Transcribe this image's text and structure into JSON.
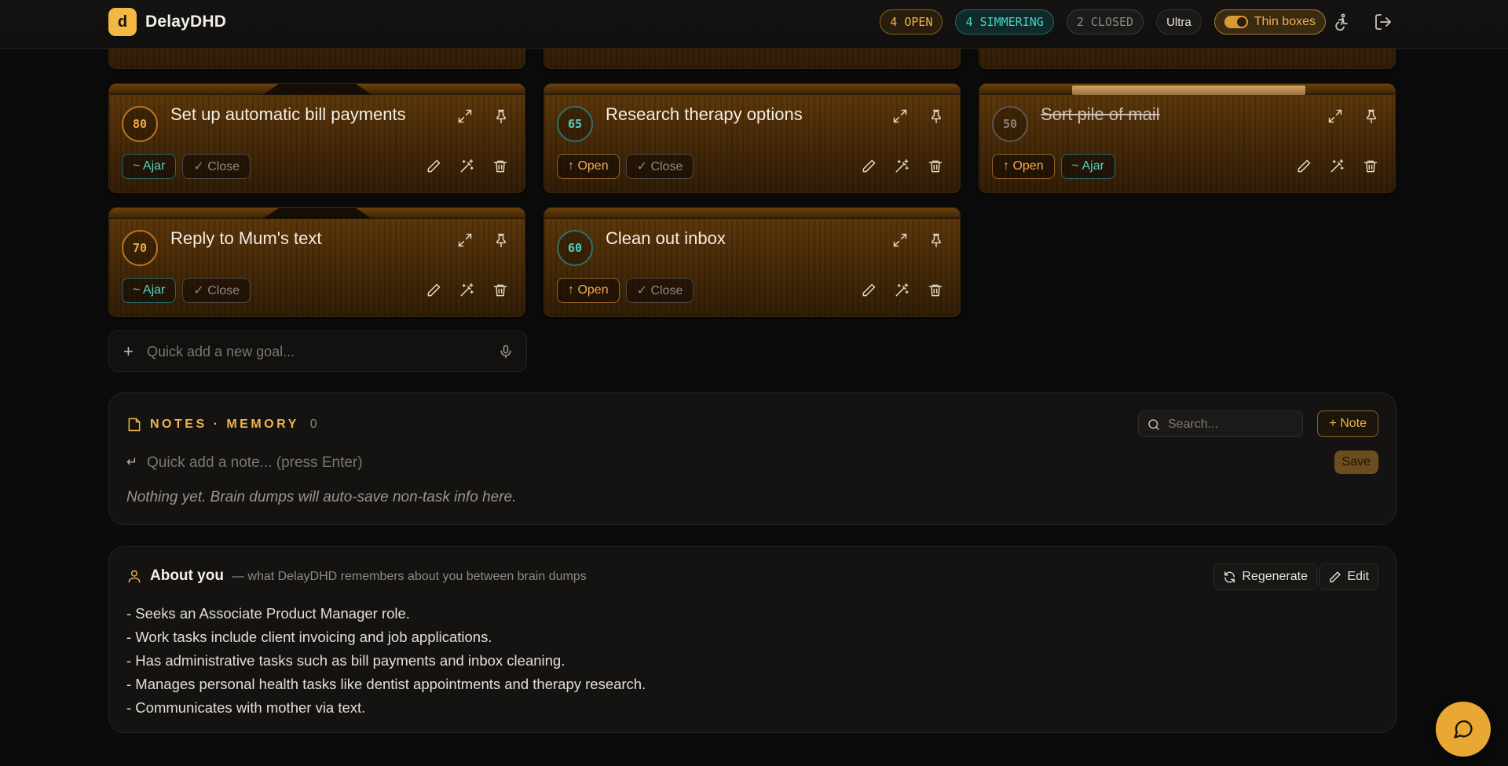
{
  "header": {
    "logo_letter": "d",
    "app_name": "DelayDHD",
    "open_label": "4 OPEN",
    "simmering_label": "4 SIMMERING",
    "closed_label": "2 CLOSED",
    "mode_label": "Ultra",
    "thin_boxes_label": "Thin boxes",
    "thin_boxes_on": true
  },
  "colors": {
    "accent": "#f0b24c",
    "teal": "#45d3c7",
    "card_wood": "#4a2b06",
    "background": "#0b0b0c"
  },
  "cards": [
    {
      "score": "80",
      "title": "Set up automatic bill payments",
      "state": "open",
      "actions": [
        "~ Ajar",
        "✓ Close"
      ]
    },
    {
      "score": "65",
      "title": "Research therapy options",
      "state": "simmering",
      "actions": [
        "↑ Open",
        "✓ Close"
      ]
    },
    {
      "score": "50",
      "title": "Sort pile of mail",
      "state": "closed",
      "actions": [
        "↑ Open",
        "~ Ajar"
      ]
    },
    {
      "score": "70",
      "title": "Reply to Mum's text",
      "state": "open",
      "actions": [
        "~ Ajar",
        "✓ Close"
      ]
    },
    {
      "score": "60",
      "title": "Clean out inbox",
      "state": "simmering",
      "actions": [
        "↑ Open",
        "✓ Close"
      ]
    }
  ],
  "quick_add": {
    "placeholder": "Quick add a new goal..."
  },
  "notes": {
    "title": "NOTES · MEMORY",
    "count": "0",
    "search_placeholder": "Search...",
    "add_label": "+ Note",
    "enter_glyph": "↵",
    "note_placeholder": "Quick add a note... (press Enter)",
    "save_label": "Save",
    "empty_text": "Nothing yet. Brain dumps will auto-save non-task info here."
  },
  "about": {
    "title": "About you",
    "subtitle": "— what DelayDHD remembers about you between brain dumps",
    "regenerate_label": "Regenerate",
    "edit_label": "Edit",
    "facts": [
      "- Seeks an Associate Product Manager role.",
      "- Work tasks include client invoicing and job applications.",
      "- Has administrative tasks such as bill payments and inbox cleaning.",
      "- Manages personal health tasks like dentist appointments and therapy research.",
      "- Communicates with mother via text."
    ]
  },
  "icons": {
    "expand": "expand-icon",
    "pin": "pin-icon",
    "edit": "pencil-icon",
    "magic": "magic-wand-icon",
    "delete": "trash-icon",
    "mic": "microphone-icon",
    "chat": "chat-bubble-icon",
    "accessibility": "accessibility-icon",
    "logout": "logout-icon"
  }
}
